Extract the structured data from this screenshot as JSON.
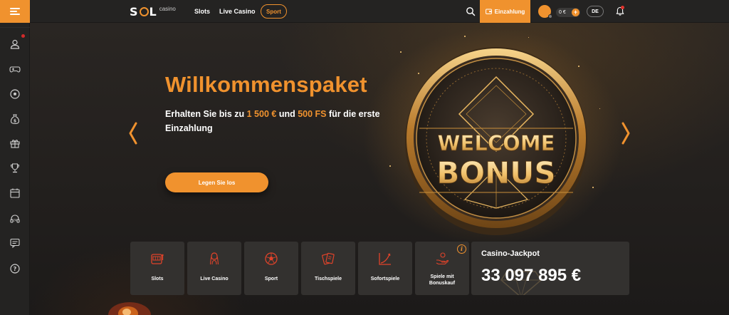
{
  "header": {
    "logo_text": "SOL",
    "logo_sub": "casino",
    "nav": {
      "slots": "Slots",
      "live_casino": "Live Casino",
      "sport": "Sport"
    },
    "deposit_label": "Einzahlung",
    "balance": "0 €",
    "balance_plus": "+",
    "language": "DE",
    "icons": [
      "menu-icon",
      "search-icon",
      "wallet-icon",
      "bell-icon"
    ]
  },
  "sidebar": {
    "items": [
      {
        "name": "sidebar-item-profile",
        "icon": "user-icon"
      },
      {
        "name": "sidebar-item-games",
        "icon": "gamepad-icon"
      },
      {
        "name": "sidebar-item-sport",
        "icon": "soccer-ball-icon"
      },
      {
        "name": "sidebar-item-bonus",
        "icon": "money-bag-icon"
      },
      {
        "name": "sidebar-item-gifts",
        "icon": "gift-icon"
      },
      {
        "name": "sidebar-item-tournaments",
        "icon": "trophy-icon"
      },
      {
        "name": "sidebar-item-calendar",
        "icon": "calendar-icon"
      },
      {
        "name": "sidebar-item-support",
        "icon": "headset-icon"
      },
      {
        "name": "sidebar-item-chat",
        "icon": "chat-icon"
      },
      {
        "name": "sidebar-item-help",
        "icon": "help-icon"
      }
    ]
  },
  "hero": {
    "title": "Willkommenspaket",
    "subtitle_pre": "Erhalten Sie bis zu ",
    "subtitle_amount": "1 500 €",
    "subtitle_mid": " und ",
    "subtitle_fs": "500 FS",
    "subtitle_post": " für die erste Einzahlung",
    "cta_label": "Legen Sie los",
    "coin_line1": "WELCOME",
    "coin_line2": "BONUS"
  },
  "categories": [
    {
      "label": "Slots",
      "icon": "slot-machine-icon"
    },
    {
      "label": "Live Casino",
      "icon": "dealer-icon"
    },
    {
      "label": "Sport",
      "icon": "soccer-ball-icon"
    },
    {
      "label": "Tischspiele",
      "icon": "cards-icon"
    },
    {
      "label": "Sofortspiele",
      "icon": "chart-growth-icon"
    },
    {
      "label": "Spiele mit Bonuskauf",
      "icon": "hand-coin-icon",
      "info": "i"
    }
  ],
  "jackpot": {
    "title": "Casino-Jackpot",
    "value": "33 097 895 €"
  },
  "colors": {
    "accent": "#f0922e",
    "background": "#1e1d1c",
    "panel": "#33312f",
    "header": "#242322"
  }
}
